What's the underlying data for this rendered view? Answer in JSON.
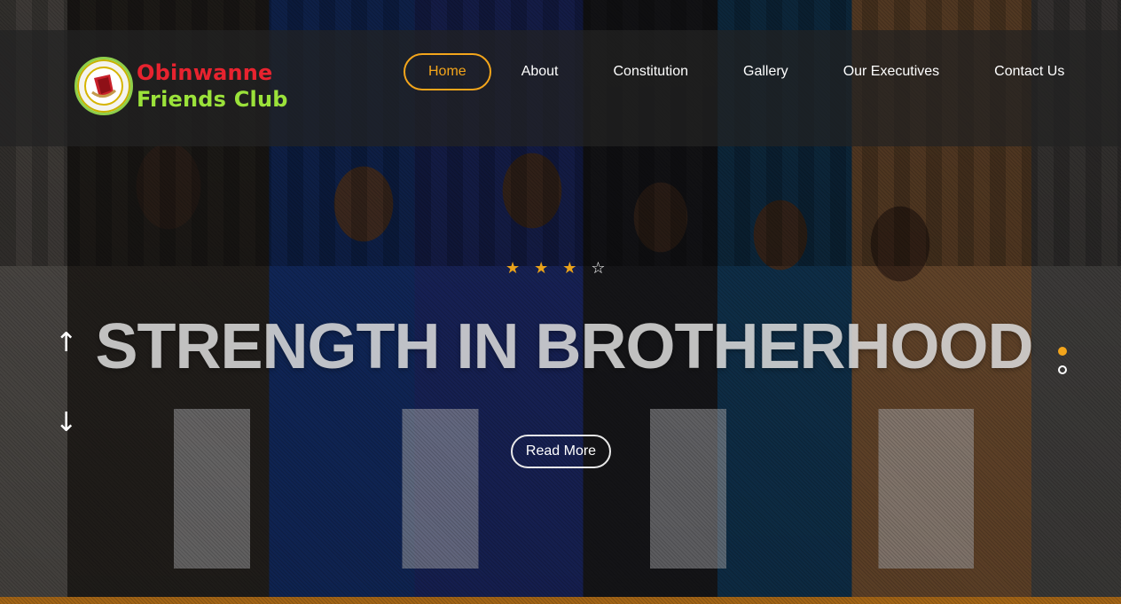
{
  "brand": {
    "line1": "Obinwanne",
    "line2": "Friends Club",
    "logo_icon": "club-crest-icon"
  },
  "nav": {
    "items": [
      {
        "label": "Home",
        "active": true
      },
      {
        "label": "About",
        "active": false
      },
      {
        "label": "Constitution",
        "active": false
      },
      {
        "label": "Gallery",
        "active": false
      },
      {
        "label": "Our Executives",
        "active": false
      },
      {
        "label": "Contact Us",
        "active": false
      }
    ]
  },
  "hero": {
    "headline": "STRENGTH IN BROTHERHOOD",
    "cta_label": "Read More",
    "prev_icon": "arrow-up-icon",
    "next_icon": "arrow-down-icon",
    "slides": 2,
    "active_slide": 1
  },
  "colors": {
    "accent": "#f3a51b",
    "brand_red": "#e8232f",
    "brand_green": "#9be23a",
    "navbar_bg": "rgba(35,35,35,0.72)"
  }
}
